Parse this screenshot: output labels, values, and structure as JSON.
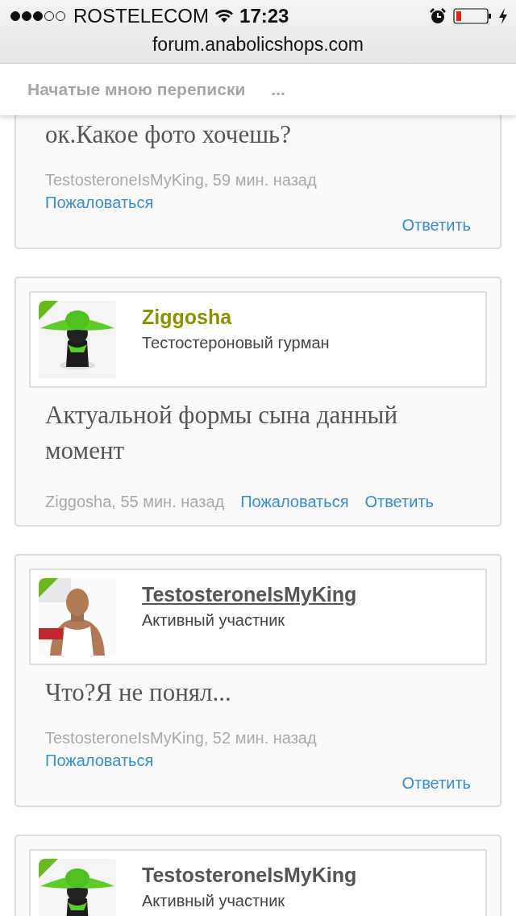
{
  "status_bar": {
    "carrier": "ROSTELECOM",
    "time": "17:23"
  },
  "browser": {
    "url": "forum.anabolicshops.com"
  },
  "nav": {
    "title": "Начатые мною переписки",
    "more": "..."
  },
  "posts": [
    {
      "text": "ок.Какое фото хочешь?",
      "kind": "stacked",
      "meta": "TestosteroneIsMyKing, 59 мин. назад",
      "report": "Пожаловаться",
      "reply": "Ответить"
    },
    {
      "author": {
        "name": "Ziggosha",
        "role": "Тестостероновый гурман",
        "color": "#8a9100",
        "underlined": false
      },
      "text": "Актуальной формы сына данный момент",
      "kind": "inline",
      "meta": "Ziggosha, 55 мин. назад",
      "report": "Пожаловаться",
      "reply": "Ответить"
    },
    {
      "author": {
        "name": "TestosteroneIsMyKing",
        "role": "Активный участник",
        "color": "#555555",
        "underlined": true
      },
      "text": "Что?Я не понял...",
      "kind": "stacked",
      "meta": "TestosteroneIsMyKing, 52 мин. назад",
      "report": "Пожаловаться",
      "reply": "Ответить"
    },
    {
      "author": {
        "name": "TestosteroneIsMyKing",
        "role": "Активный участник",
        "color": "#555555",
        "underlined": false
      }
    }
  ]
}
